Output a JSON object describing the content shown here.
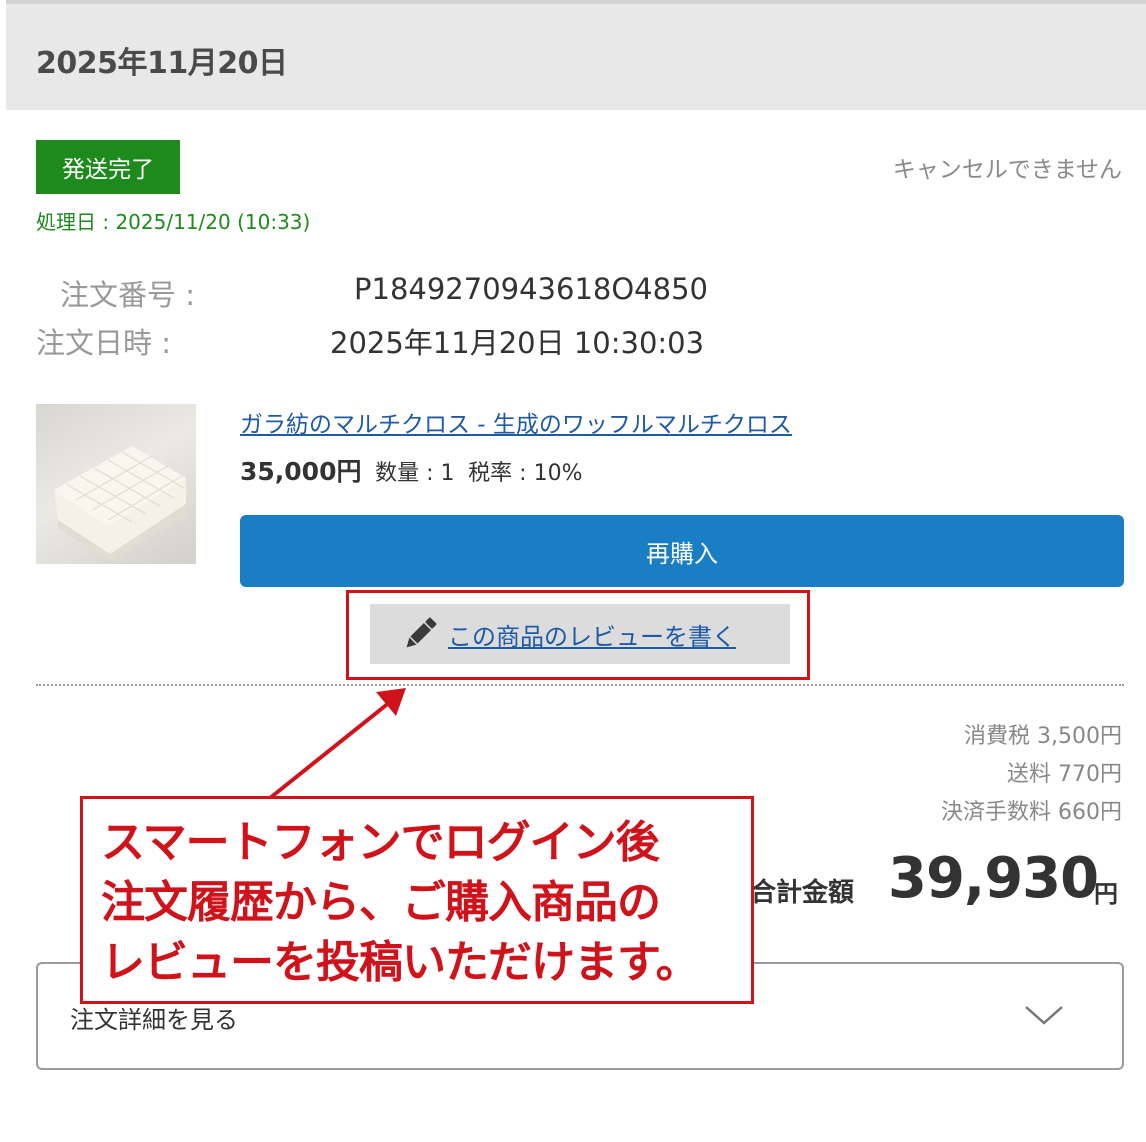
{
  "order_date_header": "2025年11月20日",
  "status": {
    "badge": "発送完了",
    "badge_color": "#1e8a1e",
    "cancel_note": "キャンセルできません",
    "processed_date": "処理日 : 2025/11/20 (10:33)"
  },
  "order_info": {
    "number_label": "注文番号 :",
    "number_value": "P1849270943618O4850",
    "datetime_label": "注文日時 :",
    "datetime_value": "2025年11月20日 10:30:03"
  },
  "product": {
    "image_icon": "folded-waffle-cloth-photo",
    "name": "ガラ紡のマルチクロス - 生成のワッフルマルチクロス",
    "price": "35,000円",
    "quantity": "数量 : 1",
    "tax_rate": "税率 : 10%"
  },
  "buttons": {
    "rebuy": "再購入",
    "rebuy_color": "#1a7ec4",
    "review": "この商品のレビューを書く",
    "review_icon": "pencil-icon"
  },
  "fees": {
    "tax": "消費税 3,500円",
    "shipping": "送料 770円",
    "payment_fee": "決済手数料 660円"
  },
  "total": {
    "label": "合計金額",
    "amount": "39,930",
    "unit": "円"
  },
  "details_toggle": {
    "label": "注文詳細を見る",
    "icon": "chevron-down-icon"
  },
  "annotation": {
    "color": "#d0121b",
    "lines": [
      "スマートフォンでログイン後",
      "注文履歴から、ご購入商品の",
      "レビューを投稿いただけます。"
    ]
  }
}
